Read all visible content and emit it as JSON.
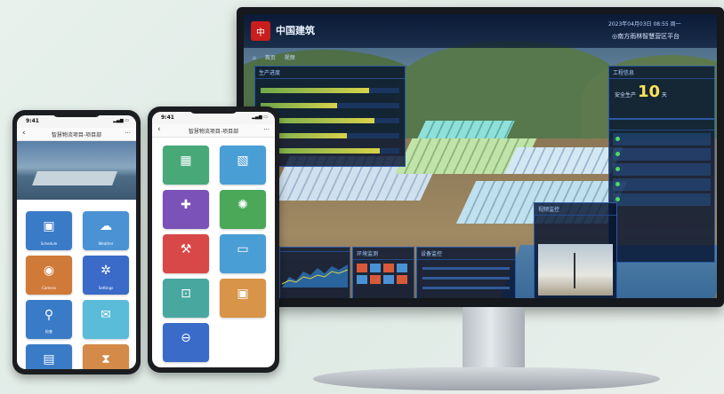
{
  "monitor": {
    "logo_glyph": "中",
    "logo_text": "中国建筑",
    "datetime": "2023年04月03日 08:55 周一",
    "platform_name": "◎南方雨林智慧营区平台",
    "subnav": [
      "首页",
      "",
      "视频"
    ],
    "left_panel": {
      "title": "生产进度",
      "bars": [
        {
          "progress": 0.78,
          "value": ""
        },
        {
          "progress": 0.55,
          "value": ""
        },
        {
          "progress": 0.82,
          "value": ""
        },
        {
          "progress": 0.62,
          "value": ""
        },
        {
          "progress": 0.86,
          "value": ""
        }
      ]
    },
    "right_panel": {
      "title": "工程信息",
      "days_label": "安全生产",
      "days_value": "10",
      "days_unit": "天"
    },
    "list_panel": {
      "title": "",
      "rows": [
        "",
        "",
        "",
        "",
        ""
      ]
    },
    "bottom_panels": {
      "chart_title": "",
      "env_title": "环境监测",
      "info_title": "设备监控",
      "video_title": "视频监控"
    },
    "colors": {
      "accent": "#2c5aa6",
      "highlight": "#ffe15a"
    }
  },
  "phone_left": {
    "time": "9:41",
    "title": "智慧物流项目-项目部",
    "tiles": [
      {
        "icon": "calendar-icon",
        "glyph": "▣",
        "label": "Schedule",
        "color": "#3a7bc8"
      },
      {
        "icon": "cloud-icon",
        "glyph": "☁",
        "label": "Weather",
        "color": "#4a92d4"
      },
      {
        "icon": "camera-icon",
        "glyph": "◉",
        "label": "Camera",
        "color": "#d07a3a"
      },
      {
        "icon": "gear-icon",
        "glyph": "✲",
        "label": "Settings",
        "color": "#3a6bc8"
      },
      {
        "icon": "search-icon",
        "glyph": "⚲",
        "label": "检查",
        "color": "#3a7bc8"
      },
      {
        "icon": "chat-icon",
        "glyph": "✉",
        "label": "",
        "color": "#5abcd8"
      },
      {
        "icon": "folder-icon",
        "glyph": "▤",
        "label": "",
        "color": "#3a7bc8"
      },
      {
        "icon": "hourglass-icon",
        "glyph": "⧗",
        "label": "",
        "color": "#d48a48"
      }
    ]
  },
  "phone_right": {
    "time": "9:41",
    "title": "智慧物流项目-项目部",
    "tiles": [
      {
        "icon": "chart-icon",
        "glyph": "▦",
        "label": "",
        "color": "#48a878"
      },
      {
        "icon": "layers-icon",
        "glyph": "▧",
        "label": "",
        "color": "#4a9ed6"
      },
      {
        "icon": "medkit-icon",
        "glyph": "✚",
        "label": "",
        "color": "#7a52b8"
      },
      {
        "icon": "lightbulb-icon",
        "glyph": "✺",
        "label": "",
        "color": "#4aa858"
      },
      {
        "icon": "tools-icon",
        "glyph": "⚒",
        "label": "",
        "color": "#d84848"
      },
      {
        "icon": "monitor-icon",
        "glyph": "▭",
        "label": "",
        "color": "#4a9ed6"
      },
      {
        "icon": "scan-icon",
        "glyph": "⊡",
        "label": "",
        "color": "#48a8a0"
      },
      {
        "icon": "photo-icon",
        "glyph": "▣",
        "label": "",
        "color": "#d89448"
      },
      {
        "icon": "minus-circle-icon",
        "glyph": "⊖",
        "label": "",
        "color": "#3a6bc8"
      }
    ]
  }
}
